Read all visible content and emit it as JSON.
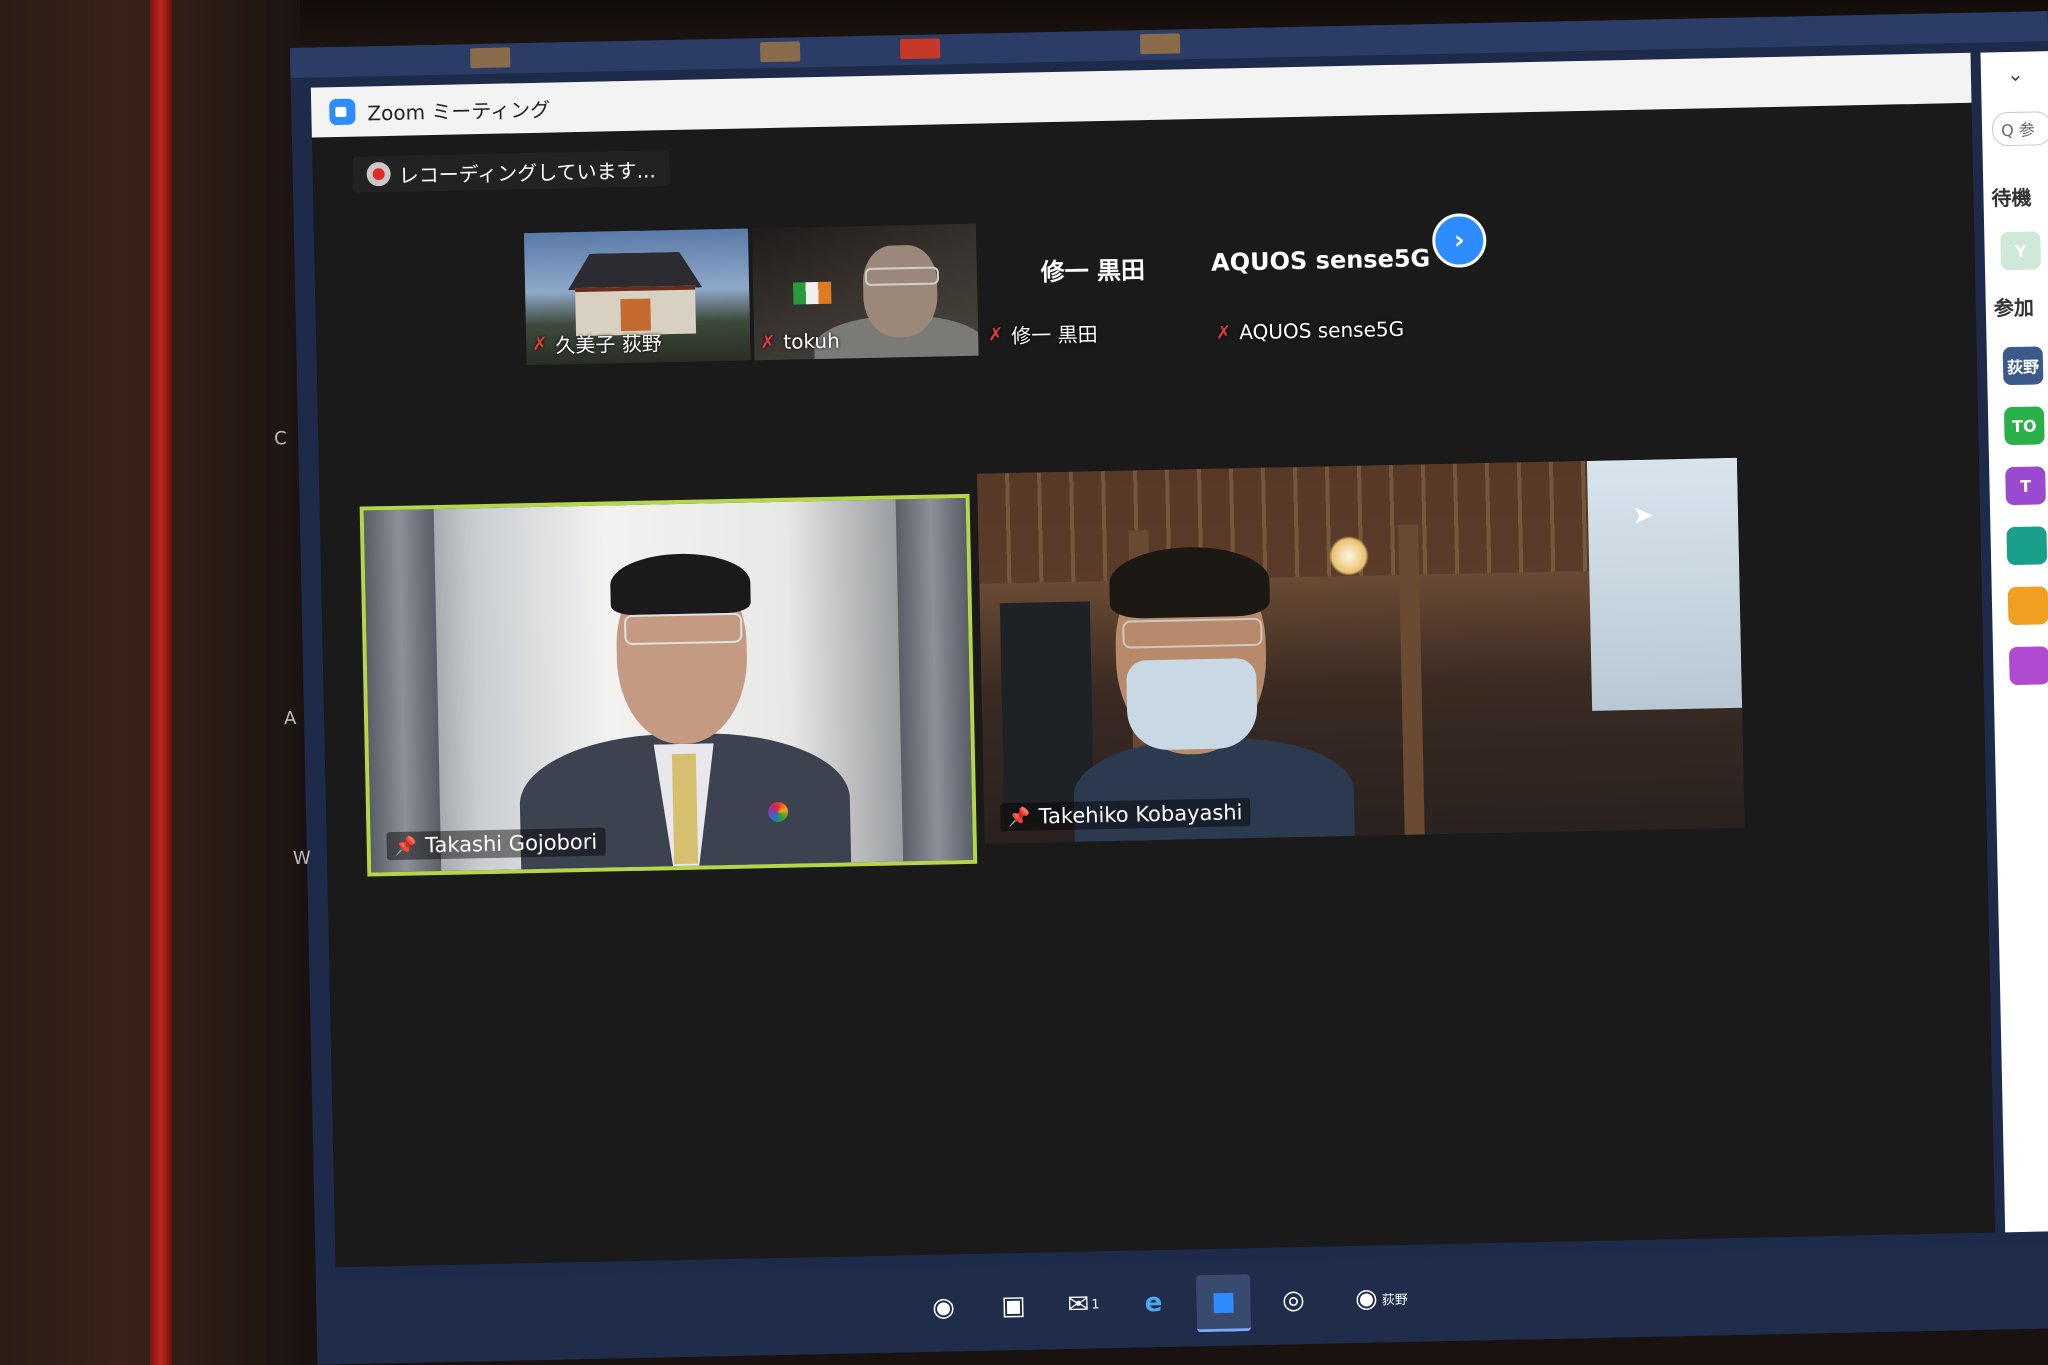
{
  "window": {
    "title": "Zoom ミーティング",
    "collapse_icon": "chevron-down-icon"
  },
  "recording": {
    "label": "レコーディングしています..."
  },
  "thumbnails": [
    {
      "name": "久美子 荻野",
      "muted": true
    },
    {
      "name": "tokuh",
      "muted": true
    },
    {
      "name": "修一 黒田",
      "center_label": "修一 黒田",
      "muted": true
    },
    {
      "name": "AQUOS sense5G",
      "center_label": "AQUOS sense5G",
      "muted": true
    }
  ],
  "gallery_next": {
    "icon": "chevron-right-icon",
    "symbol": "›"
  },
  "speakers": [
    {
      "name": "Takashi Gojobori",
      "pinned": true,
      "active": true
    },
    {
      "name": "Takehiko Kobayashi",
      "pinned": true,
      "active": false
    }
  ],
  "sidebar": {
    "search_text": "Q 参",
    "waiting_heading": "待機",
    "participants_heading": "参加",
    "avatars": [
      {
        "label": "Y",
        "color": "#cfe8d8"
      },
      {
        "label": "荻野",
        "color": "#3a5a8a"
      },
      {
        "label": "TO",
        "color": "#2ab04a"
      },
      {
        "label": "T",
        "color": "#9a4ad0"
      },
      {
        "label": "",
        "color": "#1aa08a"
      },
      {
        "label": "",
        "color": "#f0a020"
      },
      {
        "label": "",
        "color": "#b04ad0"
      }
    ]
  },
  "taskbar": {
    "items": [
      {
        "name": "chrome-icon",
        "glyph": "◉"
      },
      {
        "name": "files-icon",
        "glyph": "▣"
      },
      {
        "name": "mail-icon",
        "glyph": "✉"
      },
      {
        "name": "edge-icon",
        "glyph": "e"
      },
      {
        "name": "zoom-app-icon",
        "glyph": "■"
      },
      {
        "name": "obs-icon",
        "glyph": "◎"
      },
      {
        "name": "chrome-profile-icon",
        "glyph": "◉"
      }
    ],
    "profile_label": "荻野",
    "mail_badge": "1"
  },
  "desktop_edge_letters": [
    "C",
    "A",
    "W"
  ]
}
